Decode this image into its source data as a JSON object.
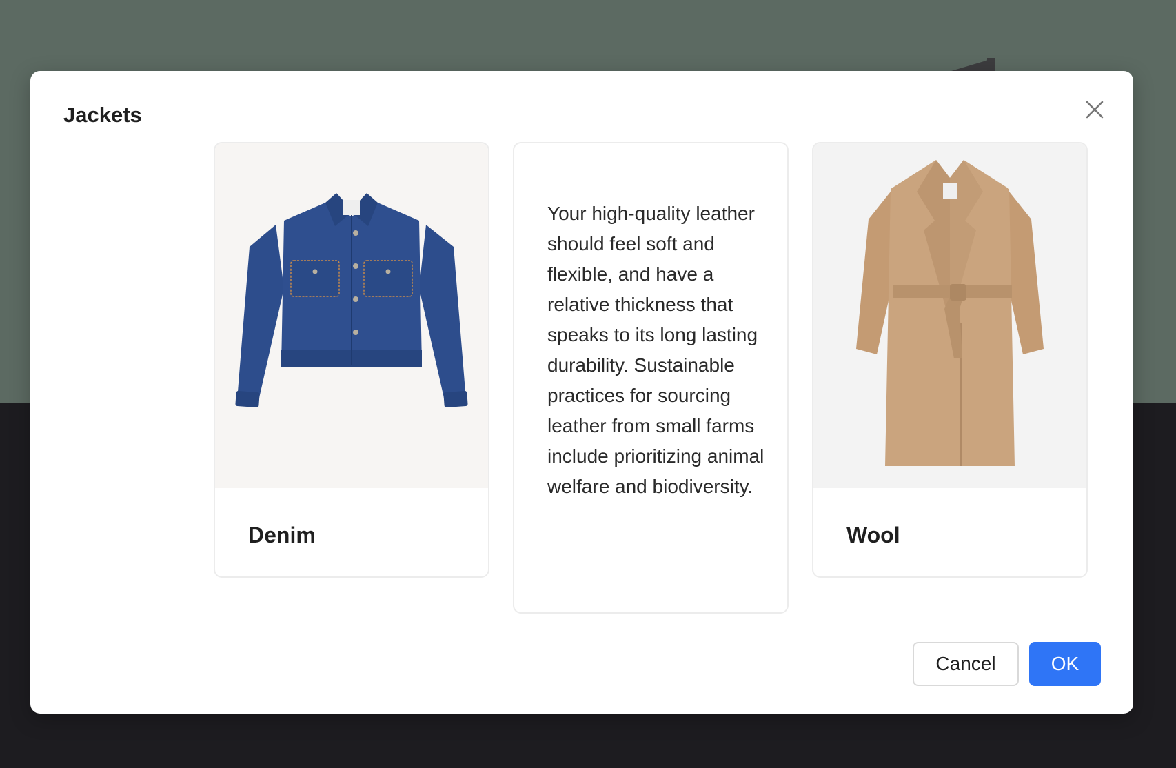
{
  "modal": {
    "title": "Jackets",
    "close_icon": "close-icon"
  },
  "cards": [
    {
      "label": "Denim",
      "image": "denim-jacket-image"
    },
    {
      "text": "Your high-quality leather should feel soft and flexible, and have a relative thickness that speaks to its long lasting durability. Sustainable practices for sourcing leather from small farms include prioritizing animal welfare and biodiversity."
    },
    {
      "label": "Wool",
      "image": "wool-coat-image"
    }
  ],
  "footer": {
    "cancel_label": "Cancel",
    "ok_label": "OK"
  },
  "colors": {
    "primary": "#2f75f6",
    "backdrop_top": "#5c6a62",
    "backdrop_bottom": "#1d1c20",
    "denim": "#2f4f8f",
    "wool": "#c9a27c"
  }
}
